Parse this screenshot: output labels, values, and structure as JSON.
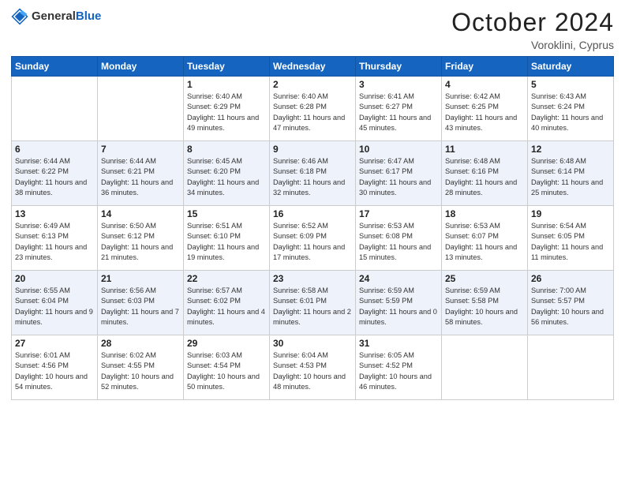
{
  "header": {
    "logo_general": "General",
    "logo_blue": "Blue",
    "title": "October 2024",
    "location": "Voroklini, Cyprus"
  },
  "weekdays": [
    "Sunday",
    "Monday",
    "Tuesday",
    "Wednesday",
    "Thursday",
    "Friday",
    "Saturday"
  ],
  "weeks": [
    [
      {
        "day": "",
        "sunrise": "",
        "sunset": "",
        "daylight": ""
      },
      {
        "day": "",
        "sunrise": "",
        "sunset": "",
        "daylight": ""
      },
      {
        "day": "1",
        "sunrise": "Sunrise: 6:40 AM",
        "sunset": "Sunset: 6:29 PM",
        "daylight": "Daylight: 11 hours and 49 minutes."
      },
      {
        "day": "2",
        "sunrise": "Sunrise: 6:40 AM",
        "sunset": "Sunset: 6:28 PM",
        "daylight": "Daylight: 11 hours and 47 minutes."
      },
      {
        "day": "3",
        "sunrise": "Sunrise: 6:41 AM",
        "sunset": "Sunset: 6:27 PM",
        "daylight": "Daylight: 11 hours and 45 minutes."
      },
      {
        "day": "4",
        "sunrise": "Sunrise: 6:42 AM",
        "sunset": "Sunset: 6:25 PM",
        "daylight": "Daylight: 11 hours and 43 minutes."
      },
      {
        "day": "5",
        "sunrise": "Sunrise: 6:43 AM",
        "sunset": "Sunset: 6:24 PM",
        "daylight": "Daylight: 11 hours and 40 minutes."
      }
    ],
    [
      {
        "day": "6",
        "sunrise": "Sunrise: 6:44 AM",
        "sunset": "Sunset: 6:22 PM",
        "daylight": "Daylight: 11 hours and 38 minutes."
      },
      {
        "day": "7",
        "sunrise": "Sunrise: 6:44 AM",
        "sunset": "Sunset: 6:21 PM",
        "daylight": "Daylight: 11 hours and 36 minutes."
      },
      {
        "day": "8",
        "sunrise": "Sunrise: 6:45 AM",
        "sunset": "Sunset: 6:20 PM",
        "daylight": "Daylight: 11 hours and 34 minutes."
      },
      {
        "day": "9",
        "sunrise": "Sunrise: 6:46 AM",
        "sunset": "Sunset: 6:18 PM",
        "daylight": "Daylight: 11 hours and 32 minutes."
      },
      {
        "day": "10",
        "sunrise": "Sunrise: 6:47 AM",
        "sunset": "Sunset: 6:17 PM",
        "daylight": "Daylight: 11 hours and 30 minutes."
      },
      {
        "day": "11",
        "sunrise": "Sunrise: 6:48 AM",
        "sunset": "Sunset: 6:16 PM",
        "daylight": "Daylight: 11 hours and 28 minutes."
      },
      {
        "day": "12",
        "sunrise": "Sunrise: 6:48 AM",
        "sunset": "Sunset: 6:14 PM",
        "daylight": "Daylight: 11 hours and 25 minutes."
      }
    ],
    [
      {
        "day": "13",
        "sunrise": "Sunrise: 6:49 AM",
        "sunset": "Sunset: 6:13 PM",
        "daylight": "Daylight: 11 hours and 23 minutes."
      },
      {
        "day": "14",
        "sunrise": "Sunrise: 6:50 AM",
        "sunset": "Sunset: 6:12 PM",
        "daylight": "Daylight: 11 hours and 21 minutes."
      },
      {
        "day": "15",
        "sunrise": "Sunrise: 6:51 AM",
        "sunset": "Sunset: 6:10 PM",
        "daylight": "Daylight: 11 hours and 19 minutes."
      },
      {
        "day": "16",
        "sunrise": "Sunrise: 6:52 AM",
        "sunset": "Sunset: 6:09 PM",
        "daylight": "Daylight: 11 hours and 17 minutes."
      },
      {
        "day": "17",
        "sunrise": "Sunrise: 6:53 AM",
        "sunset": "Sunset: 6:08 PM",
        "daylight": "Daylight: 11 hours and 15 minutes."
      },
      {
        "day": "18",
        "sunrise": "Sunrise: 6:53 AM",
        "sunset": "Sunset: 6:07 PM",
        "daylight": "Daylight: 11 hours and 13 minutes."
      },
      {
        "day": "19",
        "sunrise": "Sunrise: 6:54 AM",
        "sunset": "Sunset: 6:05 PM",
        "daylight": "Daylight: 11 hours and 11 minutes."
      }
    ],
    [
      {
        "day": "20",
        "sunrise": "Sunrise: 6:55 AM",
        "sunset": "Sunset: 6:04 PM",
        "daylight": "Daylight: 11 hours and 9 minutes."
      },
      {
        "day": "21",
        "sunrise": "Sunrise: 6:56 AM",
        "sunset": "Sunset: 6:03 PM",
        "daylight": "Daylight: 11 hours and 7 minutes."
      },
      {
        "day": "22",
        "sunrise": "Sunrise: 6:57 AM",
        "sunset": "Sunset: 6:02 PM",
        "daylight": "Daylight: 11 hours and 4 minutes."
      },
      {
        "day": "23",
        "sunrise": "Sunrise: 6:58 AM",
        "sunset": "Sunset: 6:01 PM",
        "daylight": "Daylight: 11 hours and 2 minutes."
      },
      {
        "day": "24",
        "sunrise": "Sunrise: 6:59 AM",
        "sunset": "Sunset: 5:59 PM",
        "daylight": "Daylight: 11 hours and 0 minutes."
      },
      {
        "day": "25",
        "sunrise": "Sunrise: 6:59 AM",
        "sunset": "Sunset: 5:58 PM",
        "daylight": "Daylight: 10 hours and 58 minutes."
      },
      {
        "day": "26",
        "sunrise": "Sunrise: 7:00 AM",
        "sunset": "Sunset: 5:57 PM",
        "daylight": "Daylight: 10 hours and 56 minutes."
      }
    ],
    [
      {
        "day": "27",
        "sunrise": "Sunrise: 6:01 AM",
        "sunset": "Sunset: 4:56 PM",
        "daylight": "Daylight: 10 hours and 54 minutes."
      },
      {
        "day": "28",
        "sunrise": "Sunrise: 6:02 AM",
        "sunset": "Sunset: 4:55 PM",
        "daylight": "Daylight: 10 hours and 52 minutes."
      },
      {
        "day": "29",
        "sunrise": "Sunrise: 6:03 AM",
        "sunset": "Sunset: 4:54 PM",
        "daylight": "Daylight: 10 hours and 50 minutes."
      },
      {
        "day": "30",
        "sunrise": "Sunrise: 6:04 AM",
        "sunset": "Sunset: 4:53 PM",
        "daylight": "Daylight: 10 hours and 48 minutes."
      },
      {
        "day": "31",
        "sunrise": "Sunrise: 6:05 AM",
        "sunset": "Sunset: 4:52 PM",
        "daylight": "Daylight: 10 hours and 46 minutes."
      },
      {
        "day": "",
        "sunrise": "",
        "sunset": "",
        "daylight": ""
      },
      {
        "day": "",
        "sunrise": "",
        "sunset": "",
        "daylight": ""
      }
    ]
  ]
}
